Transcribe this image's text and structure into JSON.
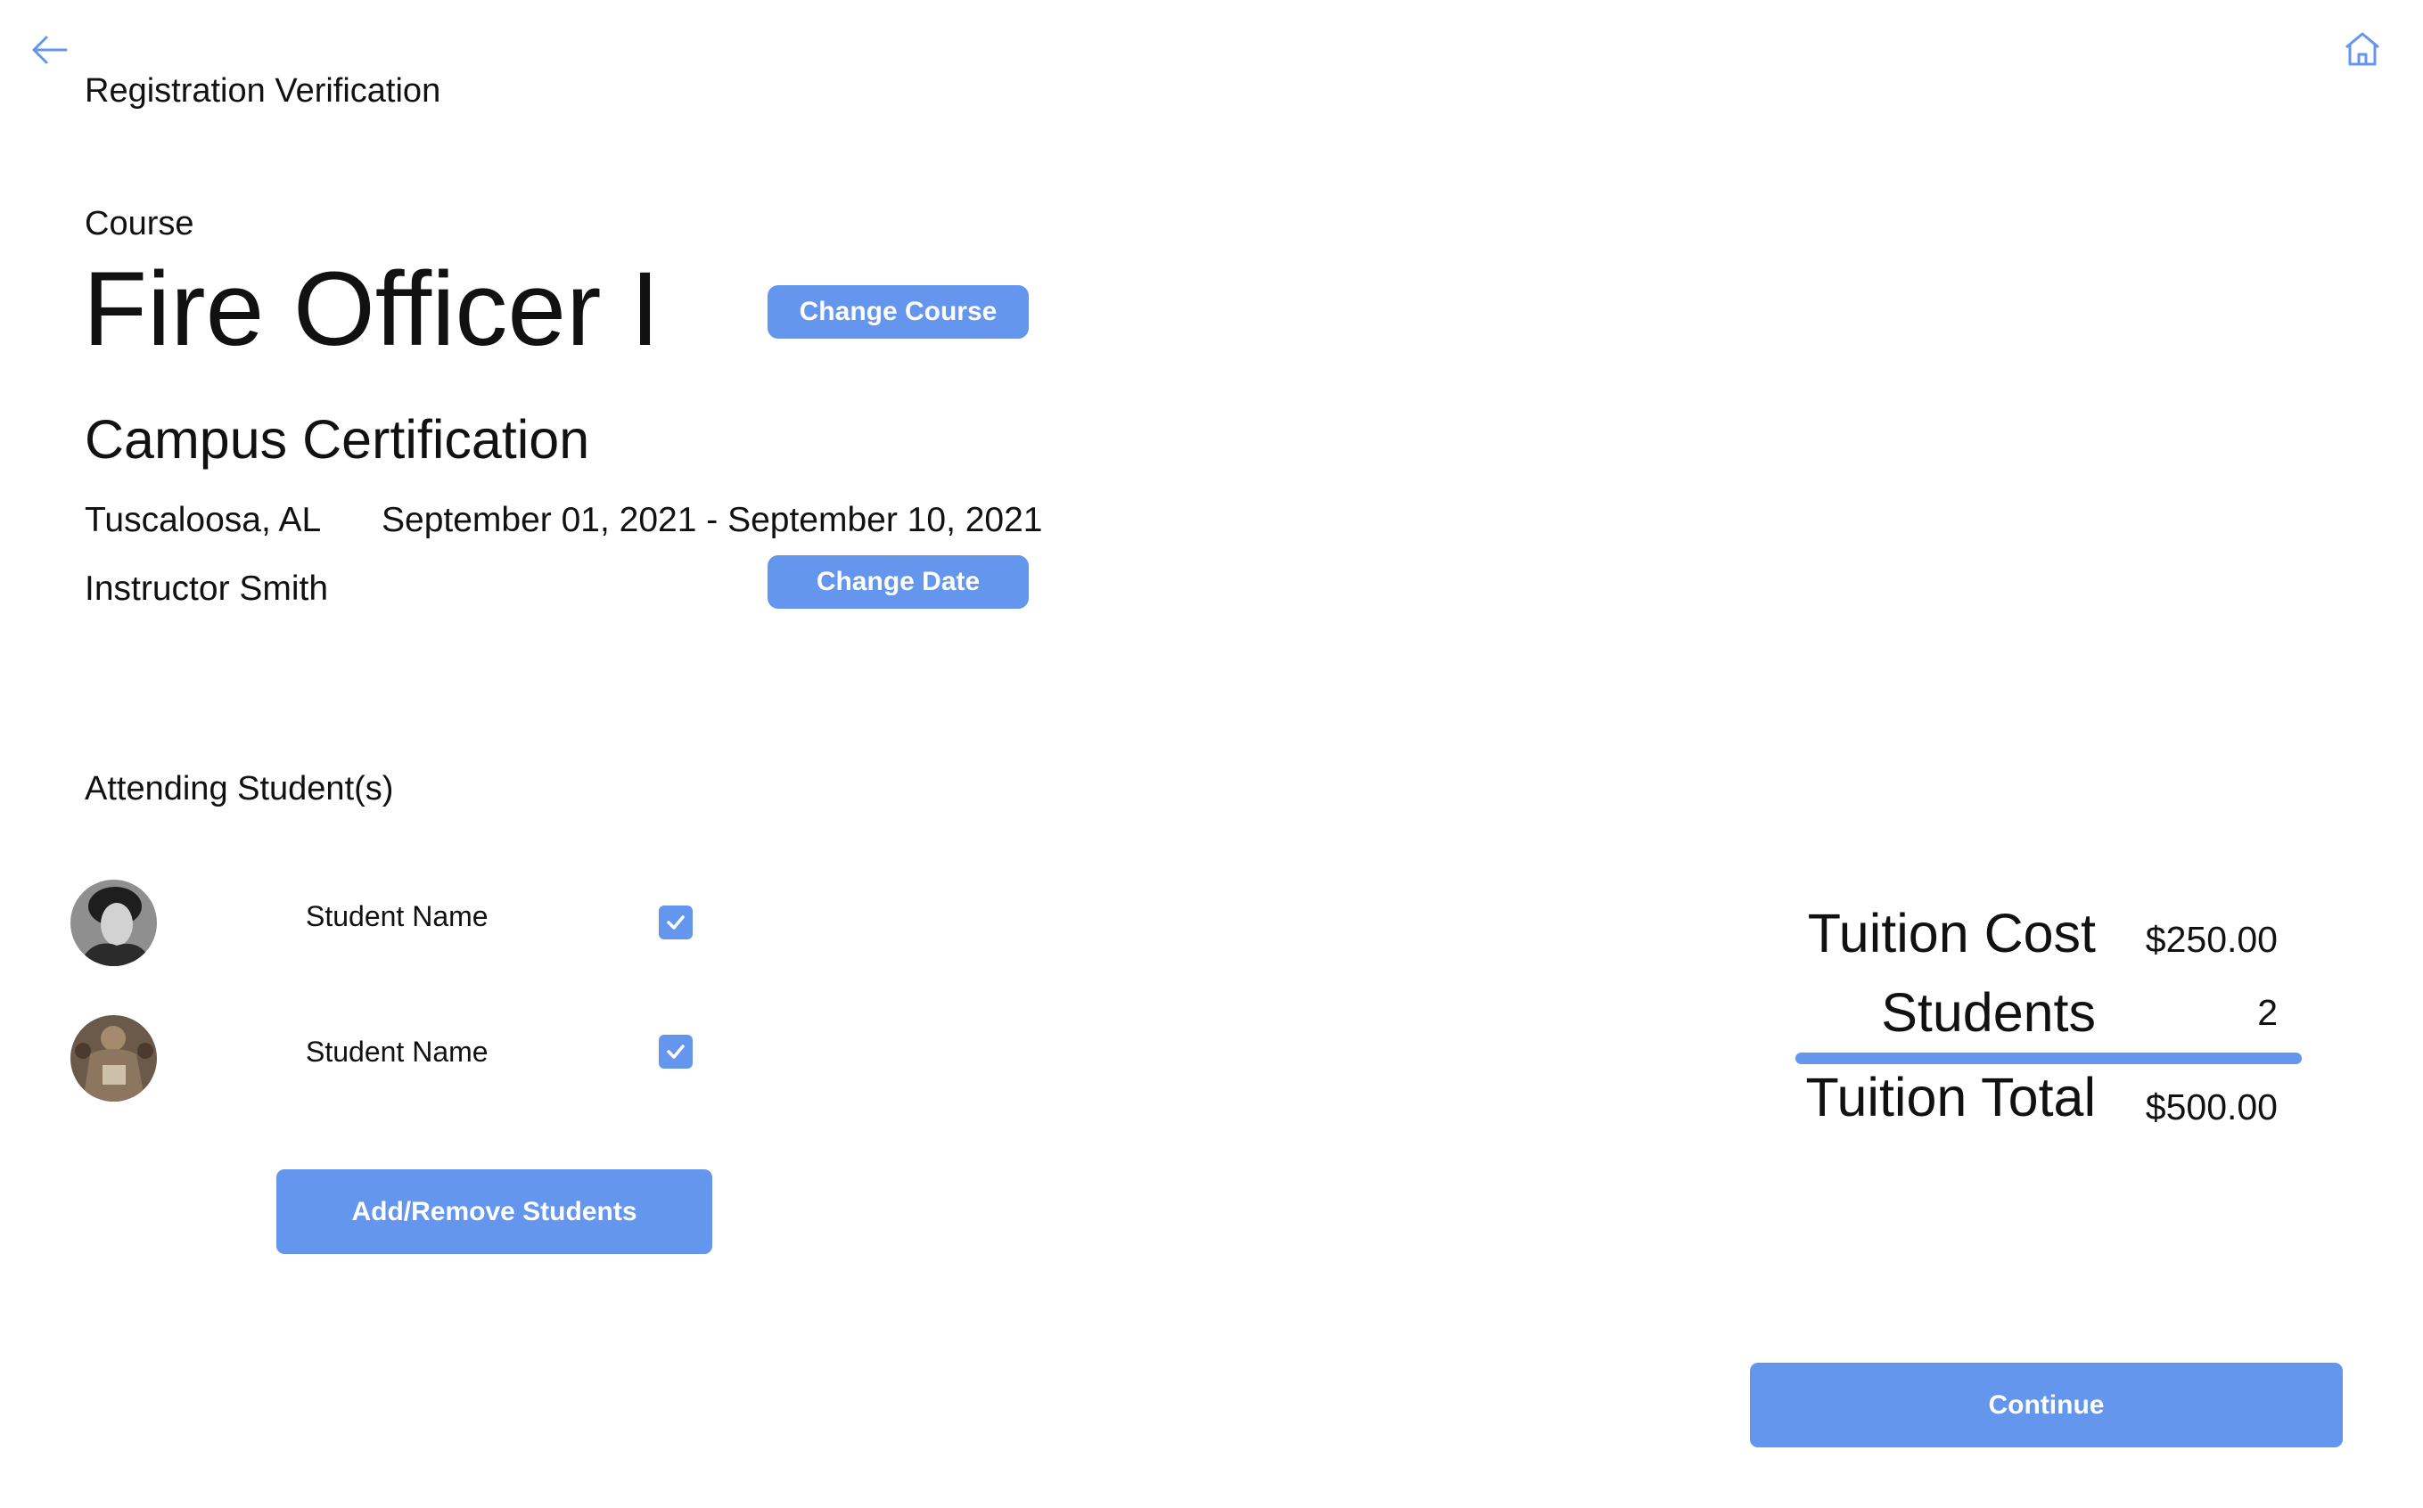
{
  "header": {
    "title": "Registration Verification",
    "back_icon": "arrow-left-icon",
    "home_icon": "home-icon"
  },
  "course": {
    "label": "Course",
    "name": "Fire Officer I",
    "change_course_label": "Change Course",
    "campus": "Campus Certification",
    "location": "Tuscaloosa, AL",
    "dates": "September 01, 2021 - September 10, 2021",
    "instructor": "Instructor Smith",
    "change_date_label": "Change Date"
  },
  "students": {
    "section_label": "Attending Student(s)",
    "items": [
      {
        "name": "Student Name",
        "checked": true
      },
      {
        "name": "Student Name",
        "checked": true
      }
    ],
    "add_remove_label": "Add/Remove Students"
  },
  "summary": {
    "tuition_cost_label": "Tuition Cost",
    "tuition_cost_value": "$250.00",
    "students_label": "Students",
    "students_value": "2",
    "tuition_total_label": "Tuition Total",
    "tuition_total_value": "$500.00"
  },
  "continue_label": "Continue",
  "colors": {
    "accent": "#6496ee",
    "text": "#111111",
    "background": "#ffffff"
  }
}
